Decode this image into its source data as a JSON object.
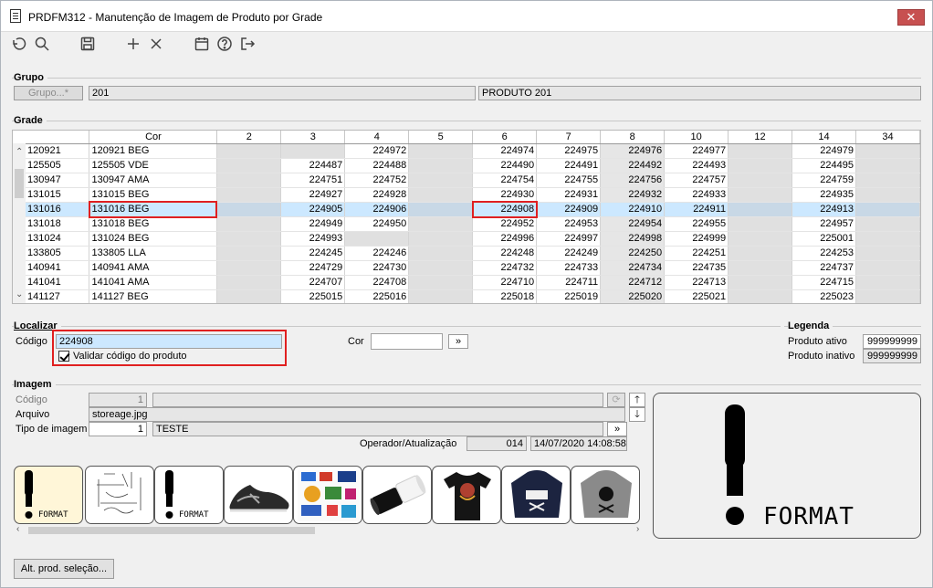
{
  "window": {
    "title": "PRDFM312 - Manutenção de Imagem de Produto por Grade",
    "close_label": "✕"
  },
  "toolbar": {
    "icons": [
      "undo-icon",
      "search-icon",
      "save-icon",
      "plus-icon",
      "delete-icon",
      "calendar-icon",
      "help-icon",
      "exit-icon"
    ]
  },
  "grupo": {
    "title": "Grupo",
    "button_label": "Grupo...*",
    "code": "201",
    "description": "PRODUTO 201"
  },
  "grade": {
    "title": "Grade",
    "columns": [
      "",
      "Cor",
      "2",
      "3",
      "4",
      "5",
      "6",
      "7",
      "8",
      "10",
      "12",
      "14",
      "34"
    ],
    "rows": [
      [
        "120921",
        "120921 BEG",
        "",
        "",
        "224972",
        "",
        "224974",
        "224975",
        "224976",
        "224977",
        "",
        "224979",
        ""
      ],
      [
        "125505",
        "125505 VDE",
        "",
        "224487",
        "224488",
        "",
        "224490",
        "224491",
        "224492",
        "224493",
        "",
        "224495",
        ""
      ],
      [
        "130947",
        "130947 AMA",
        "",
        "224751",
        "224752",
        "",
        "224754",
        "224755",
        "224756",
        "224757",
        "",
        "224759",
        ""
      ],
      [
        "131015",
        "131015 BEG",
        "",
        "224927",
        "224928",
        "",
        "224930",
        "224931",
        "224932",
        "224933",
        "",
        "224935",
        ""
      ],
      [
        "131016",
        "131016 BEG",
        "",
        "224905",
        "224906",
        "",
        "224908",
        "224909",
        "224910",
        "224911",
        "",
        "224913",
        ""
      ],
      [
        "131018",
        "131018 BEG",
        "",
        "224949",
        "224950",
        "",
        "224952",
        "224953",
        "224954",
        "224955",
        "",
        "224957",
        ""
      ],
      [
        "131024",
        "131024 BEG",
        "",
        "224993",
        "",
        "",
        "224996",
        "224997",
        "224998",
        "224999",
        "",
        "225001",
        ""
      ],
      [
        "133805",
        "133805 LLA",
        "",
        "224245",
        "224246",
        "",
        "224248",
        "224249",
        "224250",
        "224251",
        "",
        "224253",
        ""
      ],
      [
        "140941",
        "140941 AMA",
        "",
        "224729",
        "224730",
        "",
        "224732",
        "224733",
        "224734",
        "224735",
        "",
        "224737",
        ""
      ],
      [
        "141041",
        "141041 AMA",
        "",
        "224707",
        "224708",
        "",
        "224710",
        "224711",
        "224712",
        "224713",
        "",
        "224715",
        ""
      ],
      [
        "141127",
        "141127 BEG",
        "",
        "225015",
        "225016",
        "",
        "225018",
        "225019",
        "225020",
        "225021",
        "",
        "225023",
        ""
      ]
    ]
  },
  "localizar": {
    "title": "Localizar",
    "codigo_label": "Código",
    "codigo_value": "224908",
    "validar_label": "Validar código do produto",
    "cor_label": "Cor",
    "cor_value": "",
    "go_label": "»"
  },
  "legenda": {
    "title": "Legenda",
    "ativo_label": "Produto ativo",
    "ativo_value": "999999999",
    "inativo_label": "Produto inativo",
    "inativo_value": "999999999"
  },
  "imagem": {
    "title": "Imagem",
    "codigo_label": "Código",
    "codigo_value": "1",
    "arquivo_label": "Arquivo",
    "arquivo_value": "storeage.jpg",
    "tipo_label": "Tipo de imagem",
    "tipo_code": "1",
    "tipo_desc": "TESTE",
    "operador_label": "Operador/Atualização",
    "operador_value": "014",
    "atualizacao_value": "14/07/2020 14:08:58",
    "format_label": "FORMAT"
  },
  "thumbnails": [
    "format-placeholder",
    "sketch",
    "format-placeholder",
    "sneaker",
    "stickers",
    "thread-spools",
    "t-shirt",
    "hoodie-navy",
    "hoodie-gray"
  ],
  "bottom": {
    "button_label": "Alt. prod. seleção..."
  }
}
